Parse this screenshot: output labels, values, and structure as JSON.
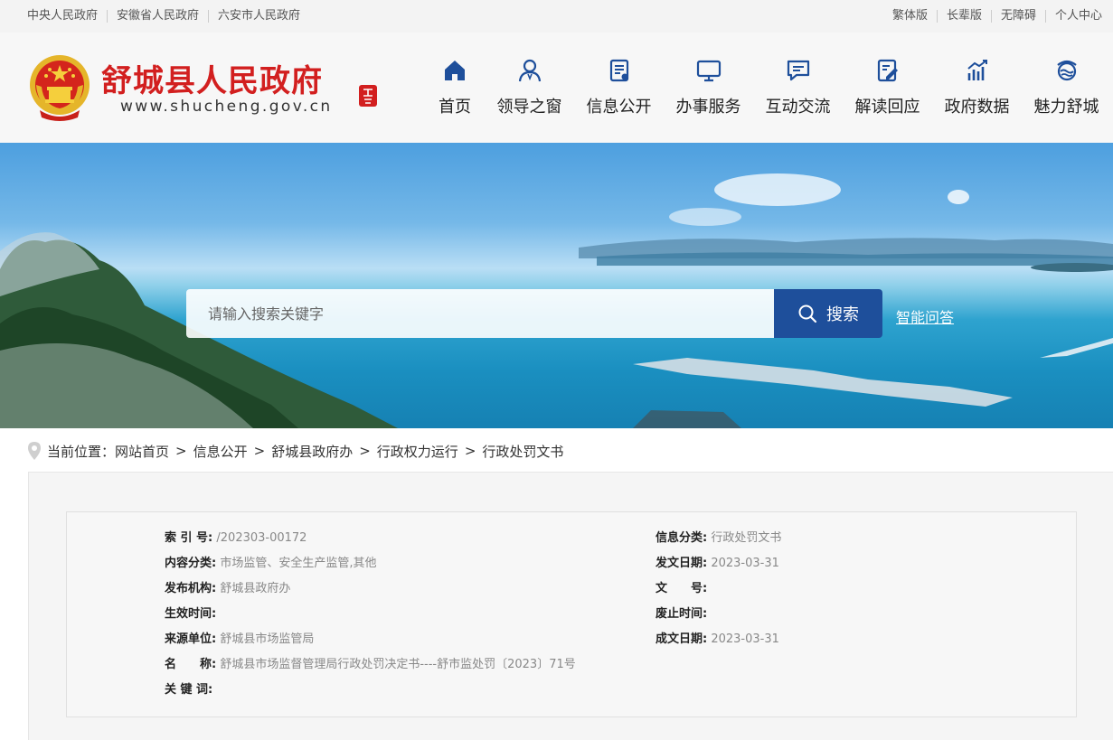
{
  "topbar": {
    "left_links": [
      "中央人民政府",
      "安徽省人民政府",
      "六安市人民政府"
    ],
    "right_links": [
      "繁体版",
      "长辈版",
      "无障碍",
      "个人中心"
    ]
  },
  "header": {
    "site_name": "舒城县人民政府",
    "site_url": "www.shucheng.gov.cn",
    "emblem_icon": "national-emblem-icon",
    "brand_color": "#d21f1f"
  },
  "nav": {
    "items": [
      {
        "label": "首页",
        "icon": "home-icon"
      },
      {
        "label": "领导之窗",
        "icon": "person-icon"
      },
      {
        "label": "信息公开",
        "icon": "document-icon"
      },
      {
        "label": "办事服务",
        "icon": "monitor-icon"
      },
      {
        "label": "互动交流",
        "icon": "chat-icon"
      },
      {
        "label": "解读回应",
        "icon": "edit-doc-icon"
      },
      {
        "label": "政府数据",
        "icon": "chart-icon"
      },
      {
        "label": "魅力舒城",
        "icon": "landscape-icon"
      }
    ],
    "icon_color": "#1e4f9b"
  },
  "search": {
    "placeholder": "请输入搜索关键字",
    "button_label": "搜索",
    "smart_qa_label": "智能问答",
    "button_color": "#1e4f9b"
  },
  "breadcrumb": {
    "prefix": "当前位置：",
    "items": [
      "网站首页",
      "信息公开",
      "舒城县政府办",
      "行政权力运行",
      "行政处罚文书"
    ],
    "separator": ">"
  },
  "meta": {
    "index_no_label": "索 引 号:",
    "index_no": "/202303-00172",
    "category_label": "信息分类:",
    "category": "行政处罚文书",
    "content_cat_label": "内容分类:",
    "content_cat": "市场监管、安全生产监管,其他",
    "issue_date_label": "发文日期:",
    "issue_date": "2023-03-31",
    "publisher_label": "发布机构:",
    "publisher": "舒城县政府办",
    "doc_no_label": "文　　号:",
    "doc_no": "",
    "effective_label": "生效时间:",
    "effective": "",
    "abolish_label": "废止时间:",
    "abolish": "",
    "source_label": "来源单位:",
    "source": "舒城县市场监管局",
    "created_label": "成文日期:",
    "created": "2023-03-31",
    "name_label": "名　　称:",
    "name": "舒城县市场监督管理局行政处罚决定书----舒市监处罚〔2023〕71号",
    "keywords_label": "关 键 词:",
    "keywords": ""
  }
}
